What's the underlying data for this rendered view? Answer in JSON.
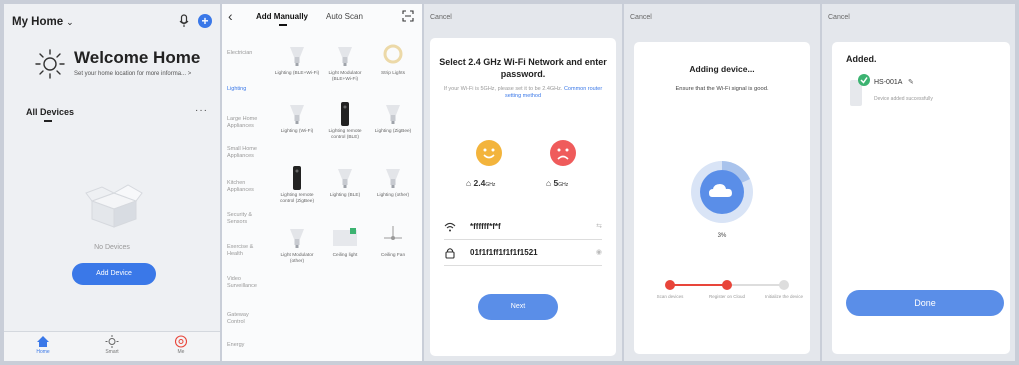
{
  "colors": {
    "accent": "#3a78e8",
    "success": "#3cb371",
    "warn": "#e8453a"
  },
  "home": {
    "title": "My Home",
    "welcome": "Welcome Home",
    "subtitle": "Set your home location for more informa... >",
    "section": "All Devices",
    "empty_text": "No Devices",
    "add_button": "Add Device",
    "nav": [
      "Home",
      "Smart",
      "Me"
    ]
  },
  "add_device": {
    "tabs": [
      "Add Manually",
      "Auto Scan"
    ],
    "categories": [
      "Electrician",
      "Lighting",
      "Large Home Appliances",
      "Small Home Appliances",
      "Kitchen Appliances",
      "Security & Sensors",
      "Exercise & Health",
      "Video Surveillance",
      "Gateway Control",
      "Energy"
    ],
    "devices": [
      "Lighting (BLE+Wi-Fi)",
      "Light Modulator (BLE+Wi-Fi)",
      "Strip Lights",
      "Lighting (Wi-Fi)",
      "Lighting remote control (BLE)",
      "Lighting (ZigBee)",
      "Lighting remote control (ZigBee)",
      "Lighting (BLE)",
      "Lighting (other)",
      "Light Modulator (other)",
      "Ceiling light",
      "Ceiling Fan"
    ]
  },
  "wifi": {
    "cancel": "Cancel",
    "title": "Select 2.4 GHz Wi-Fi Network and enter password.",
    "note": "If your Wi-Fi is 5GHz, please set it to be 2.4GHz.",
    "link": "Common router setting method",
    "band_ok": "2.4",
    "band_ok_unit": "GHz",
    "band_bad": "5",
    "band_bad_unit": "GHz",
    "ssid": "*ffffff*f*f",
    "password": "01f1f1ff1f1f1f1521",
    "next": "Next"
  },
  "adding": {
    "cancel": "Cancel",
    "title": "Adding device...",
    "subtitle": "Ensure that the Wi-Fi signal is good.",
    "progress": "3%",
    "progress_fraction": 0.03,
    "steps": [
      "Scan devices",
      "Register on Cloud",
      "Initialize the device"
    ]
  },
  "added": {
    "cancel": "Cancel",
    "title": "Added.",
    "device": "HS-001A",
    "status": "Device added successfully",
    "done": "Done"
  }
}
